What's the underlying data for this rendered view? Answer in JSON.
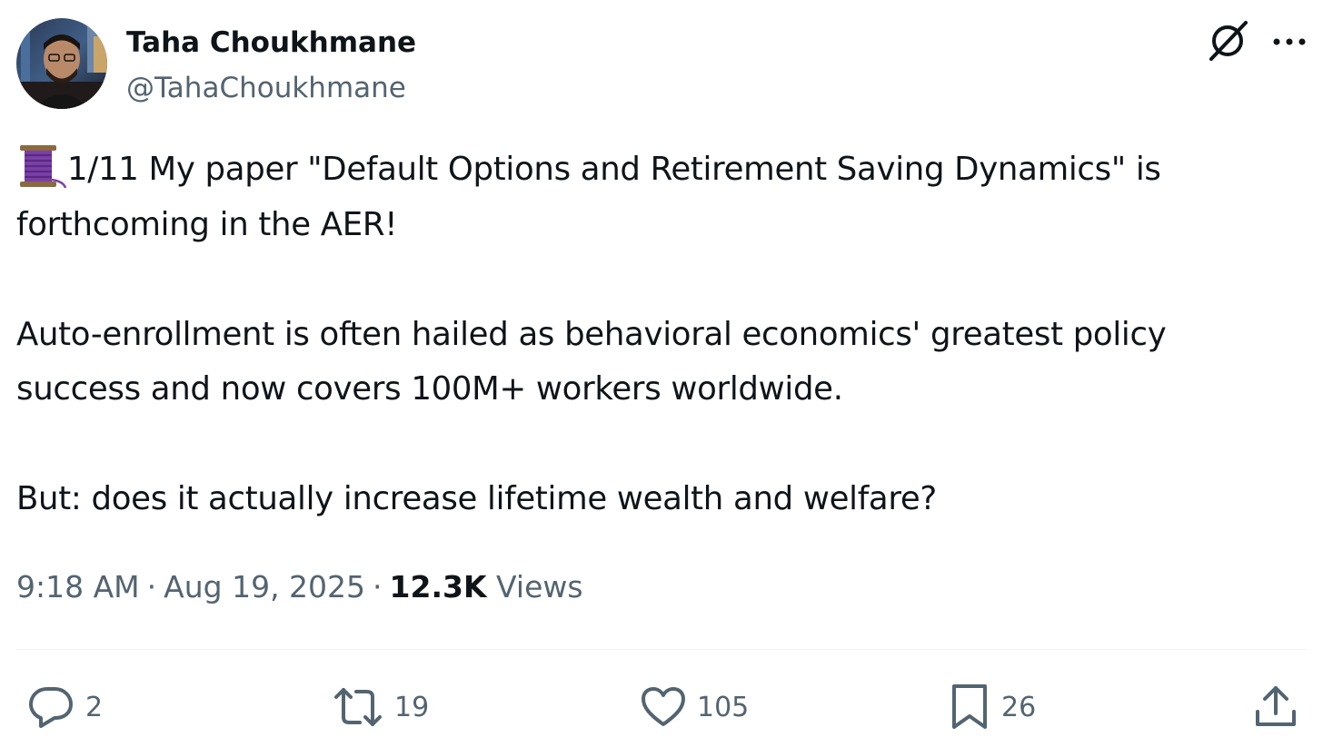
{
  "author": {
    "display_name": "Taha Choukhmane",
    "handle": "@TahaChoukhmane"
  },
  "header_icons": {
    "grok": "grok-slash-icon",
    "more": "more-dots-icon"
  },
  "tweet": {
    "thread_emoji": "spool-of-thread-icon",
    "line1": "1/11 My paper \"Default Options and Retirement Saving Dynamics\" is",
    "line2": "forthcoming in the AER!",
    "line3": "Auto-enrollment is often hailed as behavioral economics' greatest policy",
    "line4": "success and now covers 100M+ workers worldwide.",
    "line5": "But: does it actually increase lifetime wealth and welfare?"
  },
  "meta": {
    "time": "9:18 AM",
    "date": "Aug 19, 2025",
    "separator": "·",
    "views_count": "12.3K",
    "views_label": "Views"
  },
  "actions": {
    "replies": "2",
    "retweets": "19",
    "likes": "105",
    "bookmarks": "26"
  },
  "colors": {
    "text": "#0f1419",
    "secondary": "#536471",
    "divider": "#eff3f4",
    "spool": "#7b3fa8"
  }
}
